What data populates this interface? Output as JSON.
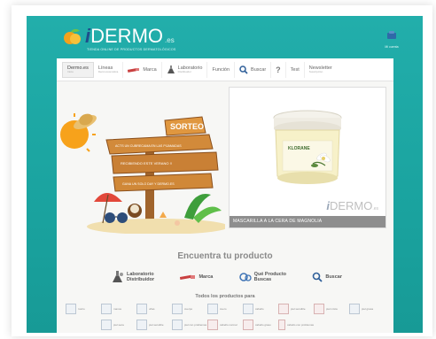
{
  "header": {
    "logo_i": "i",
    "logo_text": "DERMO",
    "logo_suffix": ".es",
    "tagline": "TIENDA ONLINE DE PRODUCTOS DERMATOLÓGICOS"
  },
  "corner": {
    "label": "Mi cuenta"
  },
  "nav": {
    "items": [
      {
        "label": "Dermo.es",
        "sub": "Inicio",
        "icon": "none",
        "active": true
      },
      {
        "label": "Líneas",
        "sub": "Dermocosmética",
        "icon": "none",
        "active": false
      },
      {
        "label": "Marca",
        "sub": "",
        "icon": "lipstick-icon",
        "active": false
      },
      {
        "label": "Laboratorio",
        "sub": "Distribuidor",
        "icon": "lab-icon",
        "active": false
      },
      {
        "label": "Función",
        "sub": "",
        "icon": "none",
        "active": false
      },
      {
        "label": "Buscar",
        "sub": "",
        "icon": "magnifier-icon",
        "active": false
      },
      {
        "label": "?",
        "sub": "",
        "icon": "question-icon",
        "active": false
      },
      {
        "label": "Test",
        "sub": "",
        "icon": "none",
        "active": false
      },
      {
        "label": "Newsletter",
        "sub": "Suscripción",
        "icon": "none",
        "active": false
      }
    ]
  },
  "banner": {
    "title": "SORTEO",
    "line1": "ACTS UN CUBRECAMA EN LAS PIJAMADAS",
    "line2": "RECIBIENDO ESTE VERANO !!",
    "line3": "GANA UN SOLO DAY Y DERMO.ES"
  },
  "product": {
    "caption": "MASCARILLA A LA CERA DE MAGNOLIA",
    "jar_label": "KLORANE"
  },
  "find": {
    "title": "Encuentra tu producto",
    "items": [
      {
        "label1": "Laboratorio",
        "label2": "Distribuidor",
        "icon": "lab-icon"
      },
      {
        "label1": "Marca",
        "label2": "",
        "icon": "lipstick-icon"
      },
      {
        "label1": "Qué Producto",
        "label2": "Buscas",
        "icon": "bubbles-icon"
      },
      {
        "label1": "Buscar",
        "label2": "",
        "icon": "magnifier-icon"
      }
    ]
  },
  "all_products": {
    "title": "Todos los productos para",
    "row1": [
      "rostro",
      "manos",
      "uñas",
      "cuerpo",
      "cuero",
      "cabello",
      "piel sensible",
      "piel mixta",
      "piel grasa"
    ],
    "row2": [
      "piel seca",
      "piel sensible",
      "piel con problemas",
      "cabello normal",
      "cabello graso",
      "cabello con problemas"
    ]
  }
}
